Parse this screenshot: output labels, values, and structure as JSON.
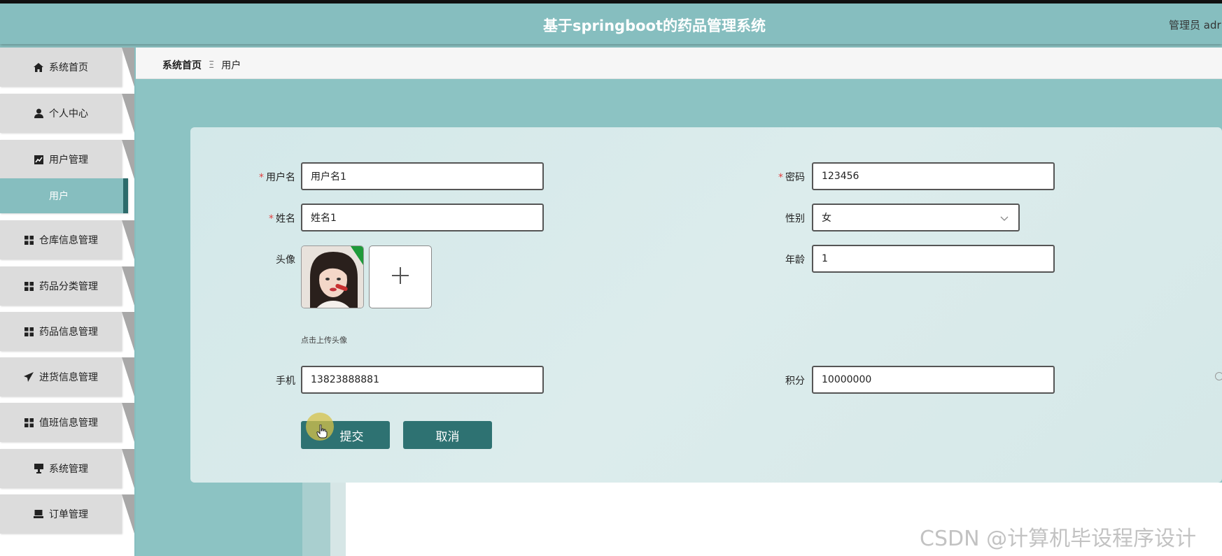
{
  "header": {
    "title": "基于springboot的药品管理系统",
    "user_label": "管理员 adr"
  },
  "sidebar": {
    "items": [
      {
        "label": "系统首页",
        "icon": "home-icon"
      },
      {
        "label": "个人中心",
        "icon": "user-icon"
      },
      {
        "label": "用户管理",
        "icon": "chart-icon"
      },
      {
        "label": "用户",
        "icon": "",
        "active": true
      },
      {
        "label": "仓库信息管理",
        "icon": "grid-icon"
      },
      {
        "label": "药品分类管理",
        "icon": "grid-icon"
      },
      {
        "label": "药品信息管理",
        "icon": "grid-icon"
      },
      {
        "label": "进货信息管理",
        "icon": "paper-plane-icon"
      },
      {
        "label": "值班信息管理",
        "icon": "grid-icon"
      },
      {
        "label": "系统管理",
        "icon": "monitor-icon"
      },
      {
        "label": "订单管理",
        "icon": "laptop-icon"
      }
    ]
  },
  "breadcrumb": {
    "home": "系统首页",
    "separator": "Ξ",
    "current": "用户"
  },
  "form": {
    "username": {
      "label": "用户名",
      "value": "用户名1",
      "required": true
    },
    "password": {
      "label": "密码",
      "value": "123456",
      "required": true
    },
    "name": {
      "label": "姓名",
      "value": "姓名1",
      "required": true
    },
    "gender": {
      "label": "性别",
      "value": "女"
    },
    "avatar": {
      "label": "头像",
      "hint": "点击上传头像"
    },
    "age": {
      "label": "年龄",
      "value": "1"
    },
    "phone": {
      "label": "手机",
      "value": "13823888881"
    },
    "points": {
      "label": "积分",
      "value": "10000000"
    },
    "required_mark": "*"
  },
  "buttons": {
    "submit": "提交",
    "cancel": "取消"
  },
  "watermark": "CSDN @计算机毕设程序设计",
  "colors": {
    "header": "#86bebf",
    "content": "#8cc3c3",
    "button": "#2e7272",
    "required": "#e04040"
  }
}
